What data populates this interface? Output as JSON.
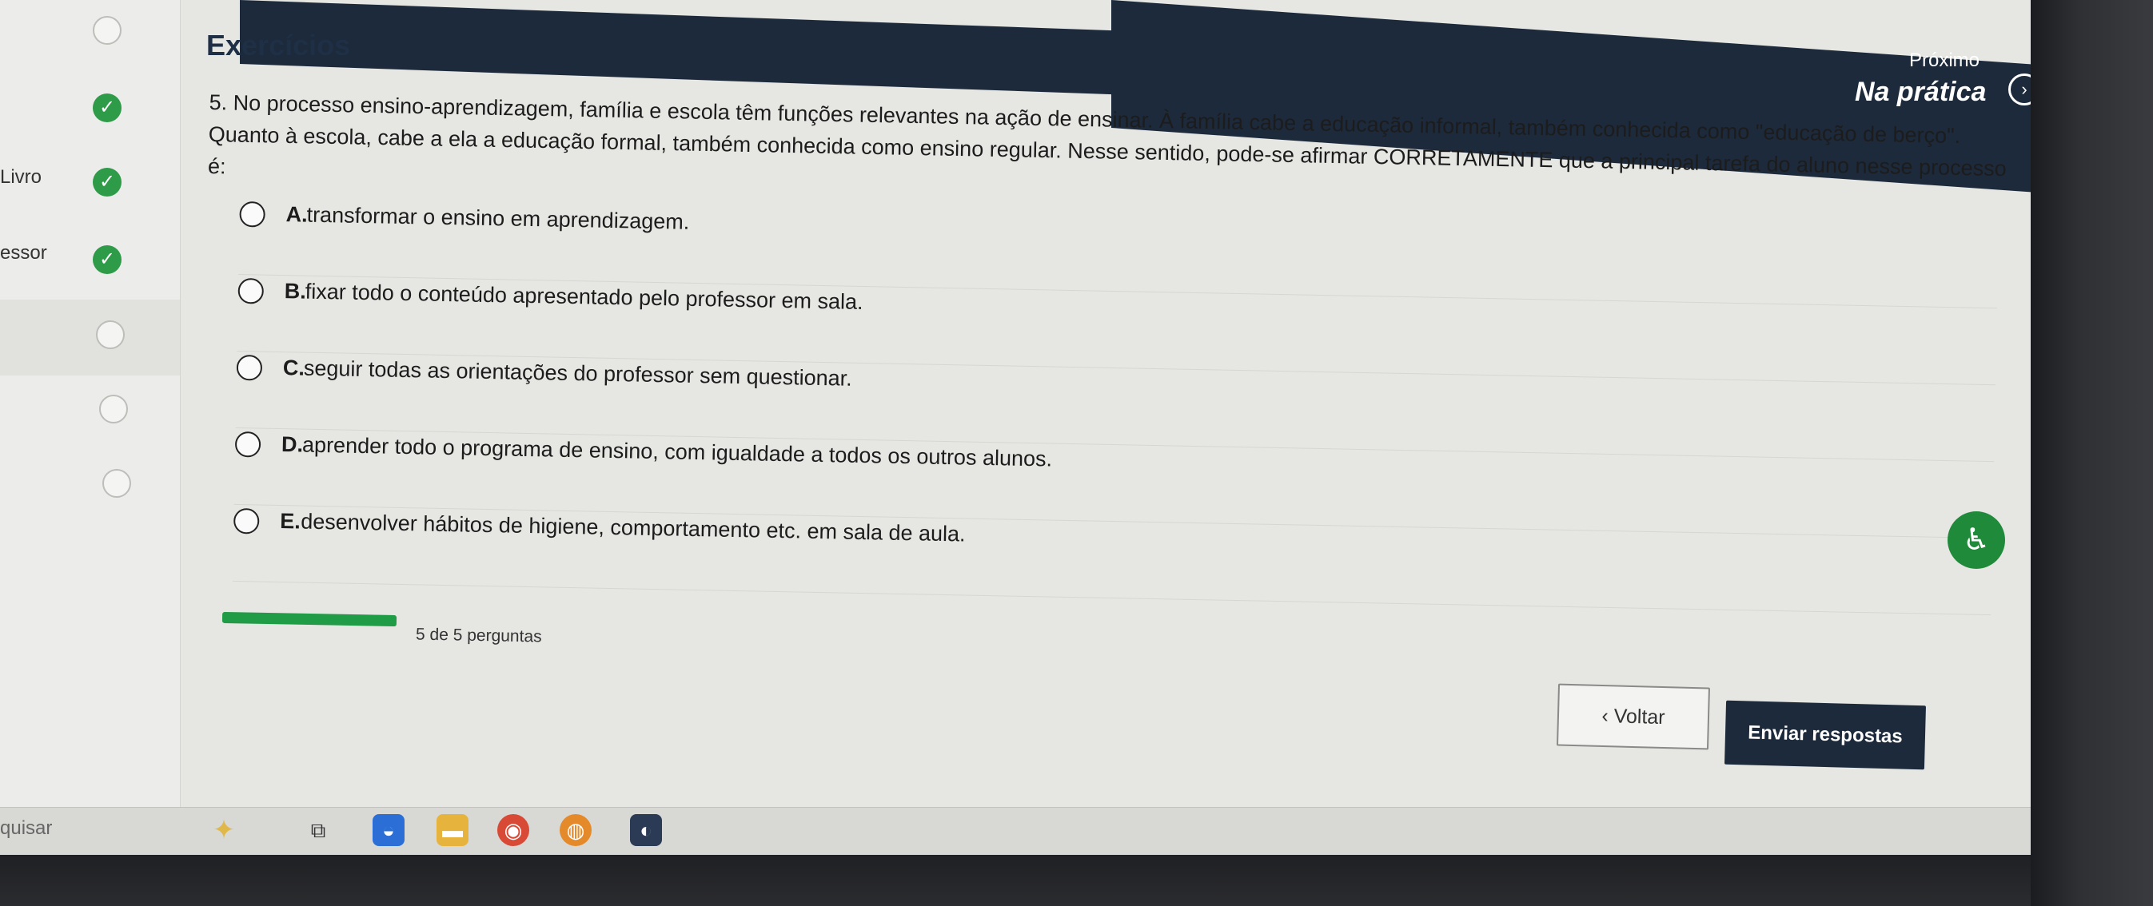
{
  "header": {
    "title": "Exercícios",
    "next_label": "Próximo",
    "next_title": "Na prática"
  },
  "sidebar": {
    "items": [
      {
        "label": "",
        "status": "empty"
      },
      {
        "label": "",
        "status": "done"
      },
      {
        "label": "Livro",
        "status": "done"
      },
      {
        "label": "essor",
        "status": "done"
      },
      {
        "label": "",
        "status": "empty"
      },
      {
        "label": "",
        "status": "empty"
      },
      {
        "label": "",
        "status": "empty"
      }
    ]
  },
  "question": {
    "text": "5. No processo ensino-aprendizagem, família e escola têm funções relevantes na ação de ensinar. À família cabe a educação informal, também conhecida como \"educação de berço\". Quanto à escola, cabe a ela a educação formal, também conhecida como ensino regular. Nesse sentido, pode-se afirmar CORRETAMENTE que a principal tarefa do aluno nesse processo é:",
    "options": [
      {
        "letter": "A.",
        "text": "transformar o ensino em aprendizagem."
      },
      {
        "letter": "B.",
        "text": "fixar todo o conteúdo apresentado pelo professor em sala."
      },
      {
        "letter": "C.",
        "text": "seguir todas as orientações do professor sem questionar."
      },
      {
        "letter": "D.",
        "text": "aprender todo o programa de ensino, com igualdade a todos os outros alunos."
      },
      {
        "letter": "E.",
        "text": "desenvolver hábitos de higiene, comportamento etc. em sala de aula."
      }
    ]
  },
  "progress": {
    "text": "5 de 5 perguntas",
    "answered": 5,
    "total": 5
  },
  "buttons": {
    "back": "Voltar",
    "submit": "Enviar respostas"
  },
  "taskbar": {
    "search": "quisar"
  },
  "colors": {
    "navy": "#1c2a3c",
    "green": "#2d9b48"
  }
}
